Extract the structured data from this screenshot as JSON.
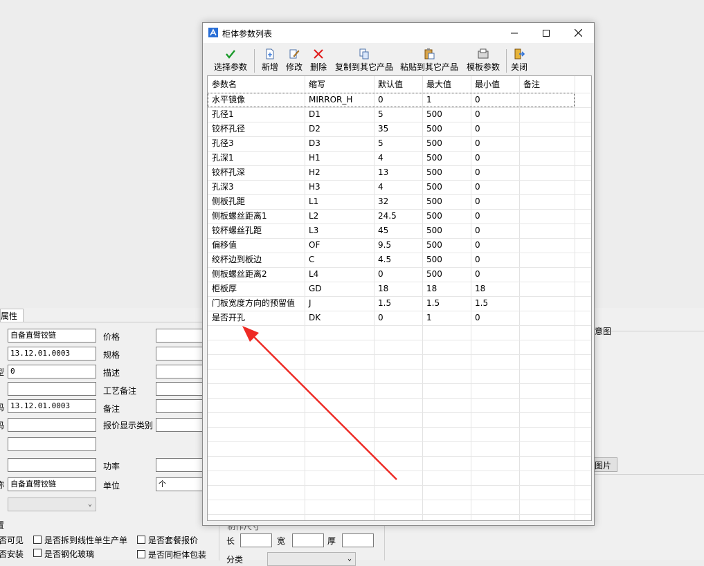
{
  "dialog": {
    "title": "柜体参数列表",
    "toolbar": {
      "select": "选择参数",
      "new": "新增",
      "edit": "修改",
      "delete": "删除",
      "copy": "复制到其它产品",
      "paste": "粘贴到其它产品",
      "template": "模板参数",
      "close": "关闭"
    },
    "columns": [
      "参数名",
      "缩写",
      "默认值",
      "最大值",
      "最小值",
      "备注"
    ],
    "rows": [
      [
        "水平镜像",
        "MIRROR_H",
        "0",
        "1",
        "0",
        ""
      ],
      [
        "孔径1",
        "D1",
        "5",
        "500",
        "0",
        ""
      ],
      [
        "铰杯孔径",
        "D2",
        "35",
        "500",
        "0",
        ""
      ],
      [
        "孔径3",
        "D3",
        "5",
        "500",
        "0",
        ""
      ],
      [
        "孔深1",
        "H1",
        "4",
        "500",
        "0",
        ""
      ],
      [
        "铰杯孔深",
        "H2",
        "13",
        "500",
        "0",
        ""
      ],
      [
        "孔深3",
        "H3",
        "4",
        "500",
        "0",
        ""
      ],
      [
        "侧板孔距",
        "L1",
        "32",
        "500",
        "0",
        ""
      ],
      [
        "侧板螺丝距离1",
        "L2",
        "24.5",
        "500",
        "0",
        ""
      ],
      [
        "铰杯螺丝孔距",
        "L3",
        "45",
        "500",
        "0",
        ""
      ],
      [
        "偏移值",
        "OF",
        "9.5",
        "500",
        "0",
        ""
      ],
      [
        "绞杯边到板边",
        "C",
        "4.5",
        "500",
        "0",
        ""
      ],
      [
        "侧板螺丝距离2",
        "L4",
        "0",
        "500",
        "0",
        ""
      ],
      [
        "柜板厚",
        "GD",
        "18",
        "18",
        "18",
        ""
      ],
      [
        "门板宽度方向的预留值",
        "J",
        "1.5",
        "1.5",
        "1.5",
        ""
      ],
      [
        "是否开孔",
        "DK",
        "0",
        "1",
        "0",
        ""
      ]
    ]
  },
  "background": {
    "tab_label": "属性",
    "name_value": "自备直臂铰链",
    "code_value": "13.12.01.0003",
    "field3_value": "0",
    "code2_value": "13.12.01.0003",
    "name2_value": "自备直臂铰链",
    "labels": {
      "price": "价格",
      "spec": "规格",
      "desc": "描述",
      "process_note": "工艺备注",
      "note": "备注",
      "quote_type": "报价显示类别",
      "power": "功率",
      "unit": "单位"
    },
    "unit_value": "个",
    "left_cut_labels": {
      "l1": "型",
      "l2": "码",
      "l3": "码",
      "l4": "称",
      "l5": "置"
    },
    "checkboxes": {
      "visible": "否可见",
      "install": "否安装",
      "split_line": "是否拆到线性单生产单",
      "tempered_glass": "是否钢化玻璃",
      "package_quote": "是否套餐报价",
      "same_cabinet_pack": "是否同柜体包装"
    },
    "right_panel": {
      "diagram_label": "意图",
      "image_button": "图片",
      "size_label": "制作尺寸",
      "length": "长",
      "width": "宽",
      "thickness": "厚",
      "category": "分类"
    }
  }
}
